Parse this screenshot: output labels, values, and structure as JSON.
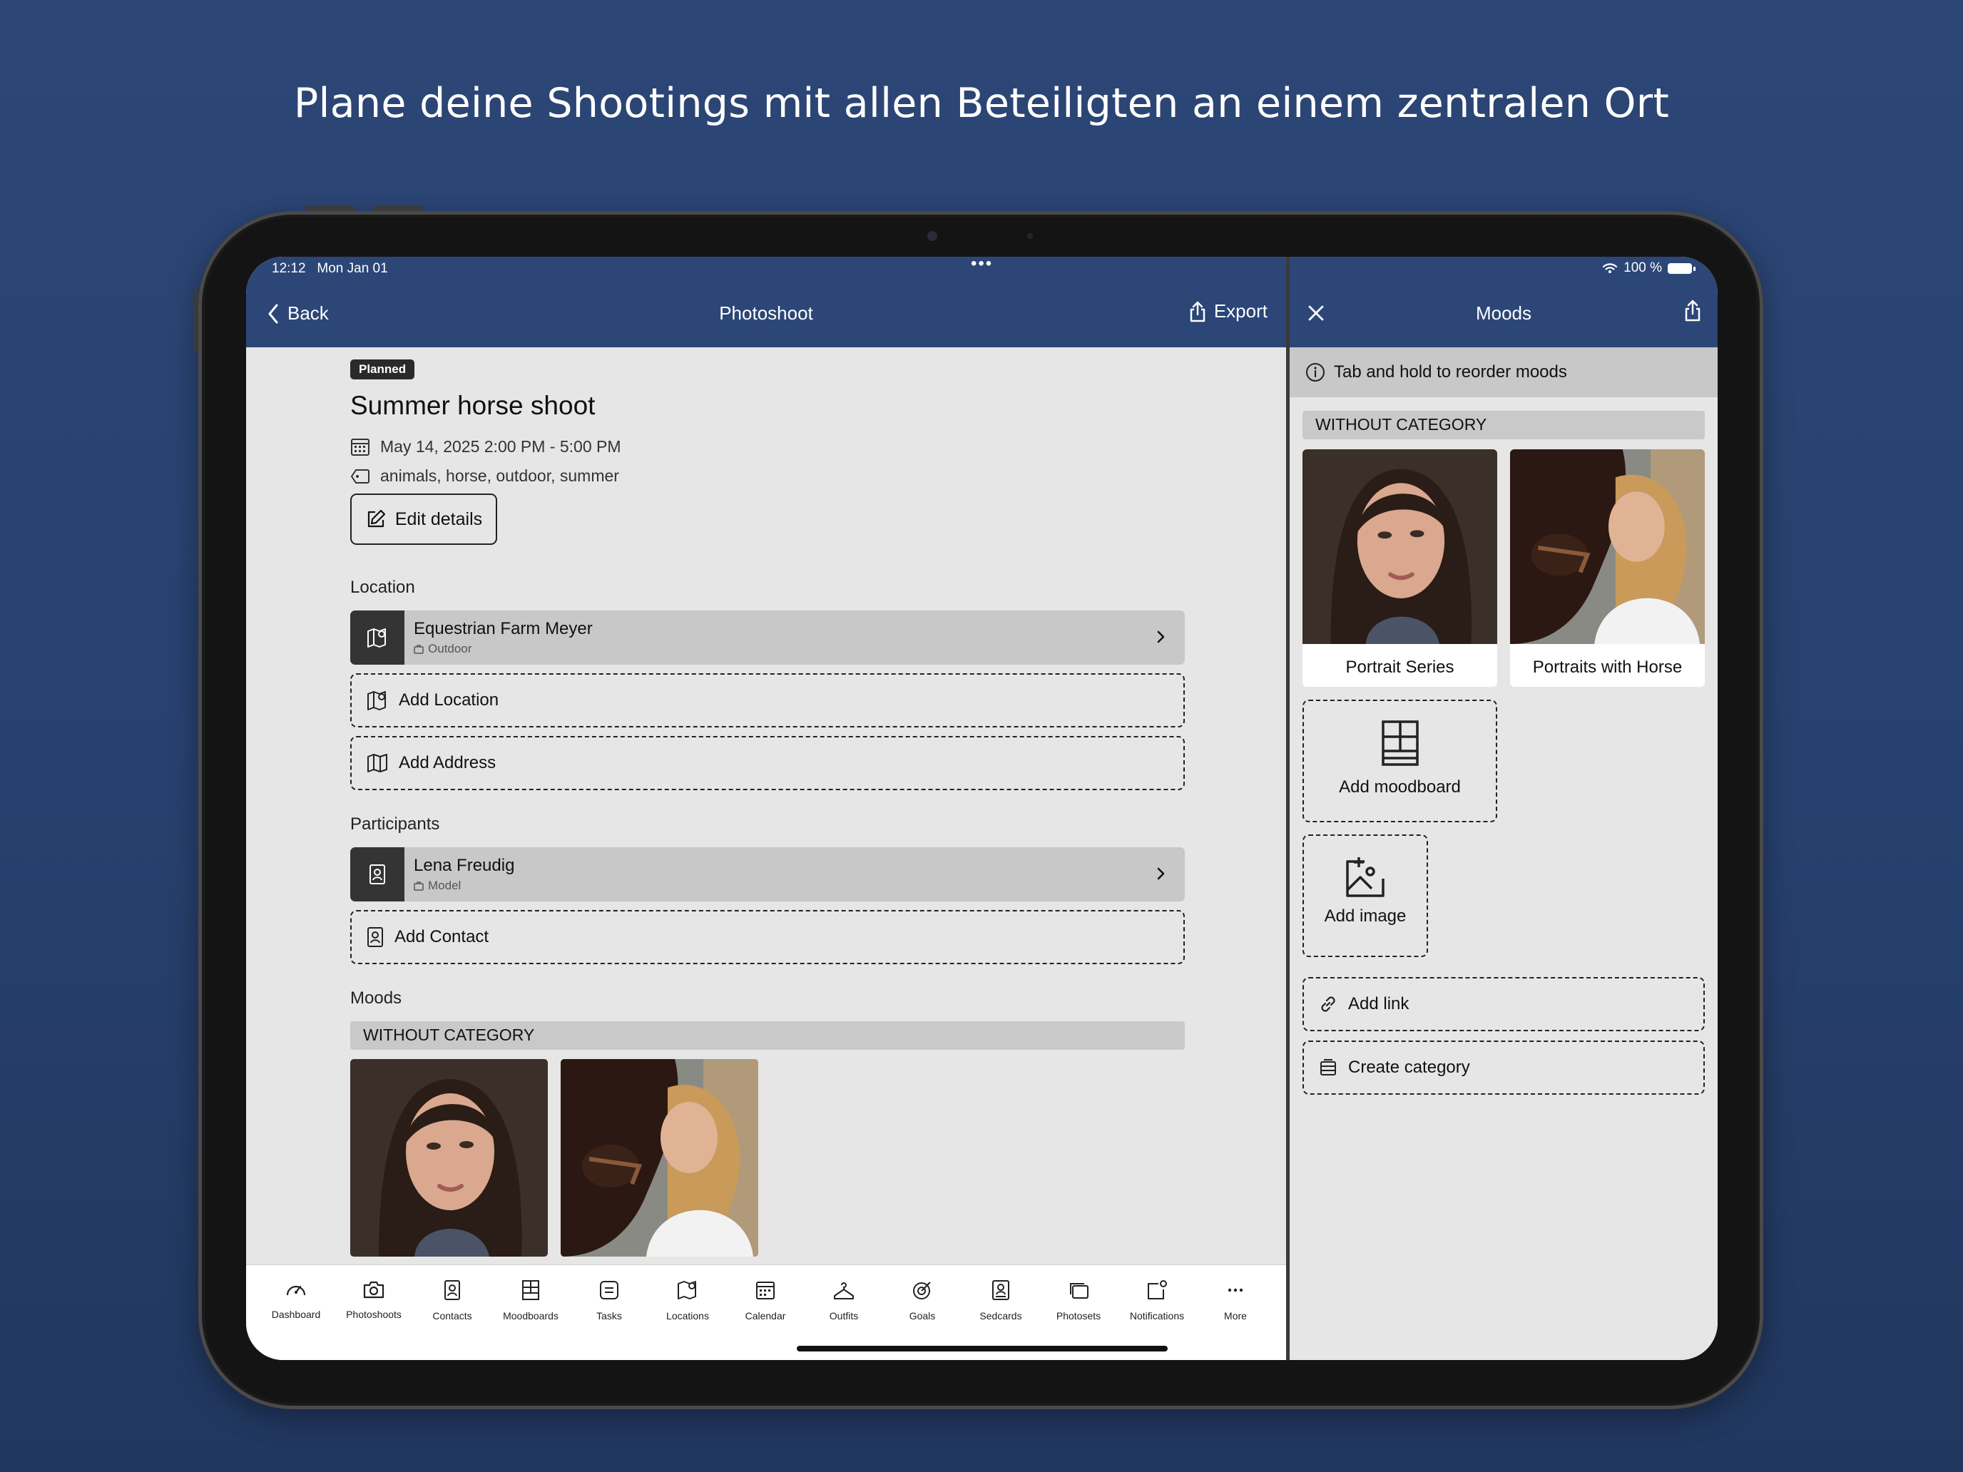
{
  "headline": "Plane deine Shootings mit allen Beteiligten an einem zentralen Ort",
  "status_bar": {
    "time": "12:12",
    "date": "Mon Jan 01",
    "battery": "100 %"
  },
  "nav": {
    "back": "Back",
    "title": "Photoshoot",
    "export": "Export"
  },
  "shoot": {
    "status": "Planned",
    "title": "Summer horse shoot",
    "datetime": "May 14, 2025 2:00 PM - 5:00 PM",
    "tags": "animals, horse, outdoor, summer",
    "edit_label": "Edit details"
  },
  "location": {
    "label": "Location",
    "item": {
      "name": "Equestrian Farm Meyer",
      "type": "Outdoor"
    },
    "add_location": "Add Location",
    "add_address": "Add Address"
  },
  "participants": {
    "label": "Participants",
    "item": {
      "name": "Lena Freudig",
      "role": "Model"
    },
    "add_contact": "Add Contact"
  },
  "moods": {
    "label": "Moods",
    "category": "WITHOUT CATEGORY"
  },
  "tabs": [
    "Dashboard",
    "Photoshoots",
    "Contacts",
    "Moodboards",
    "Tasks",
    "Locations",
    "Calendar",
    "Outfits",
    "Goals",
    "Sedcards",
    "Photosets",
    "Notifications",
    "More"
  ],
  "moods_panel": {
    "title": "Moods",
    "hint": "Tab and hold to reorder moods",
    "category": "WITHOUT CATEGORY",
    "cards": [
      {
        "caption": "Portrait Series"
      },
      {
        "caption": "Portraits with Horse"
      }
    ],
    "add_moodboard": "Add moodboard",
    "add_image": "Add image",
    "add_link": "Add link",
    "create_category": "Create category"
  },
  "colors": {
    "brand": "#2b4677",
    "background": "#2c4676"
  }
}
